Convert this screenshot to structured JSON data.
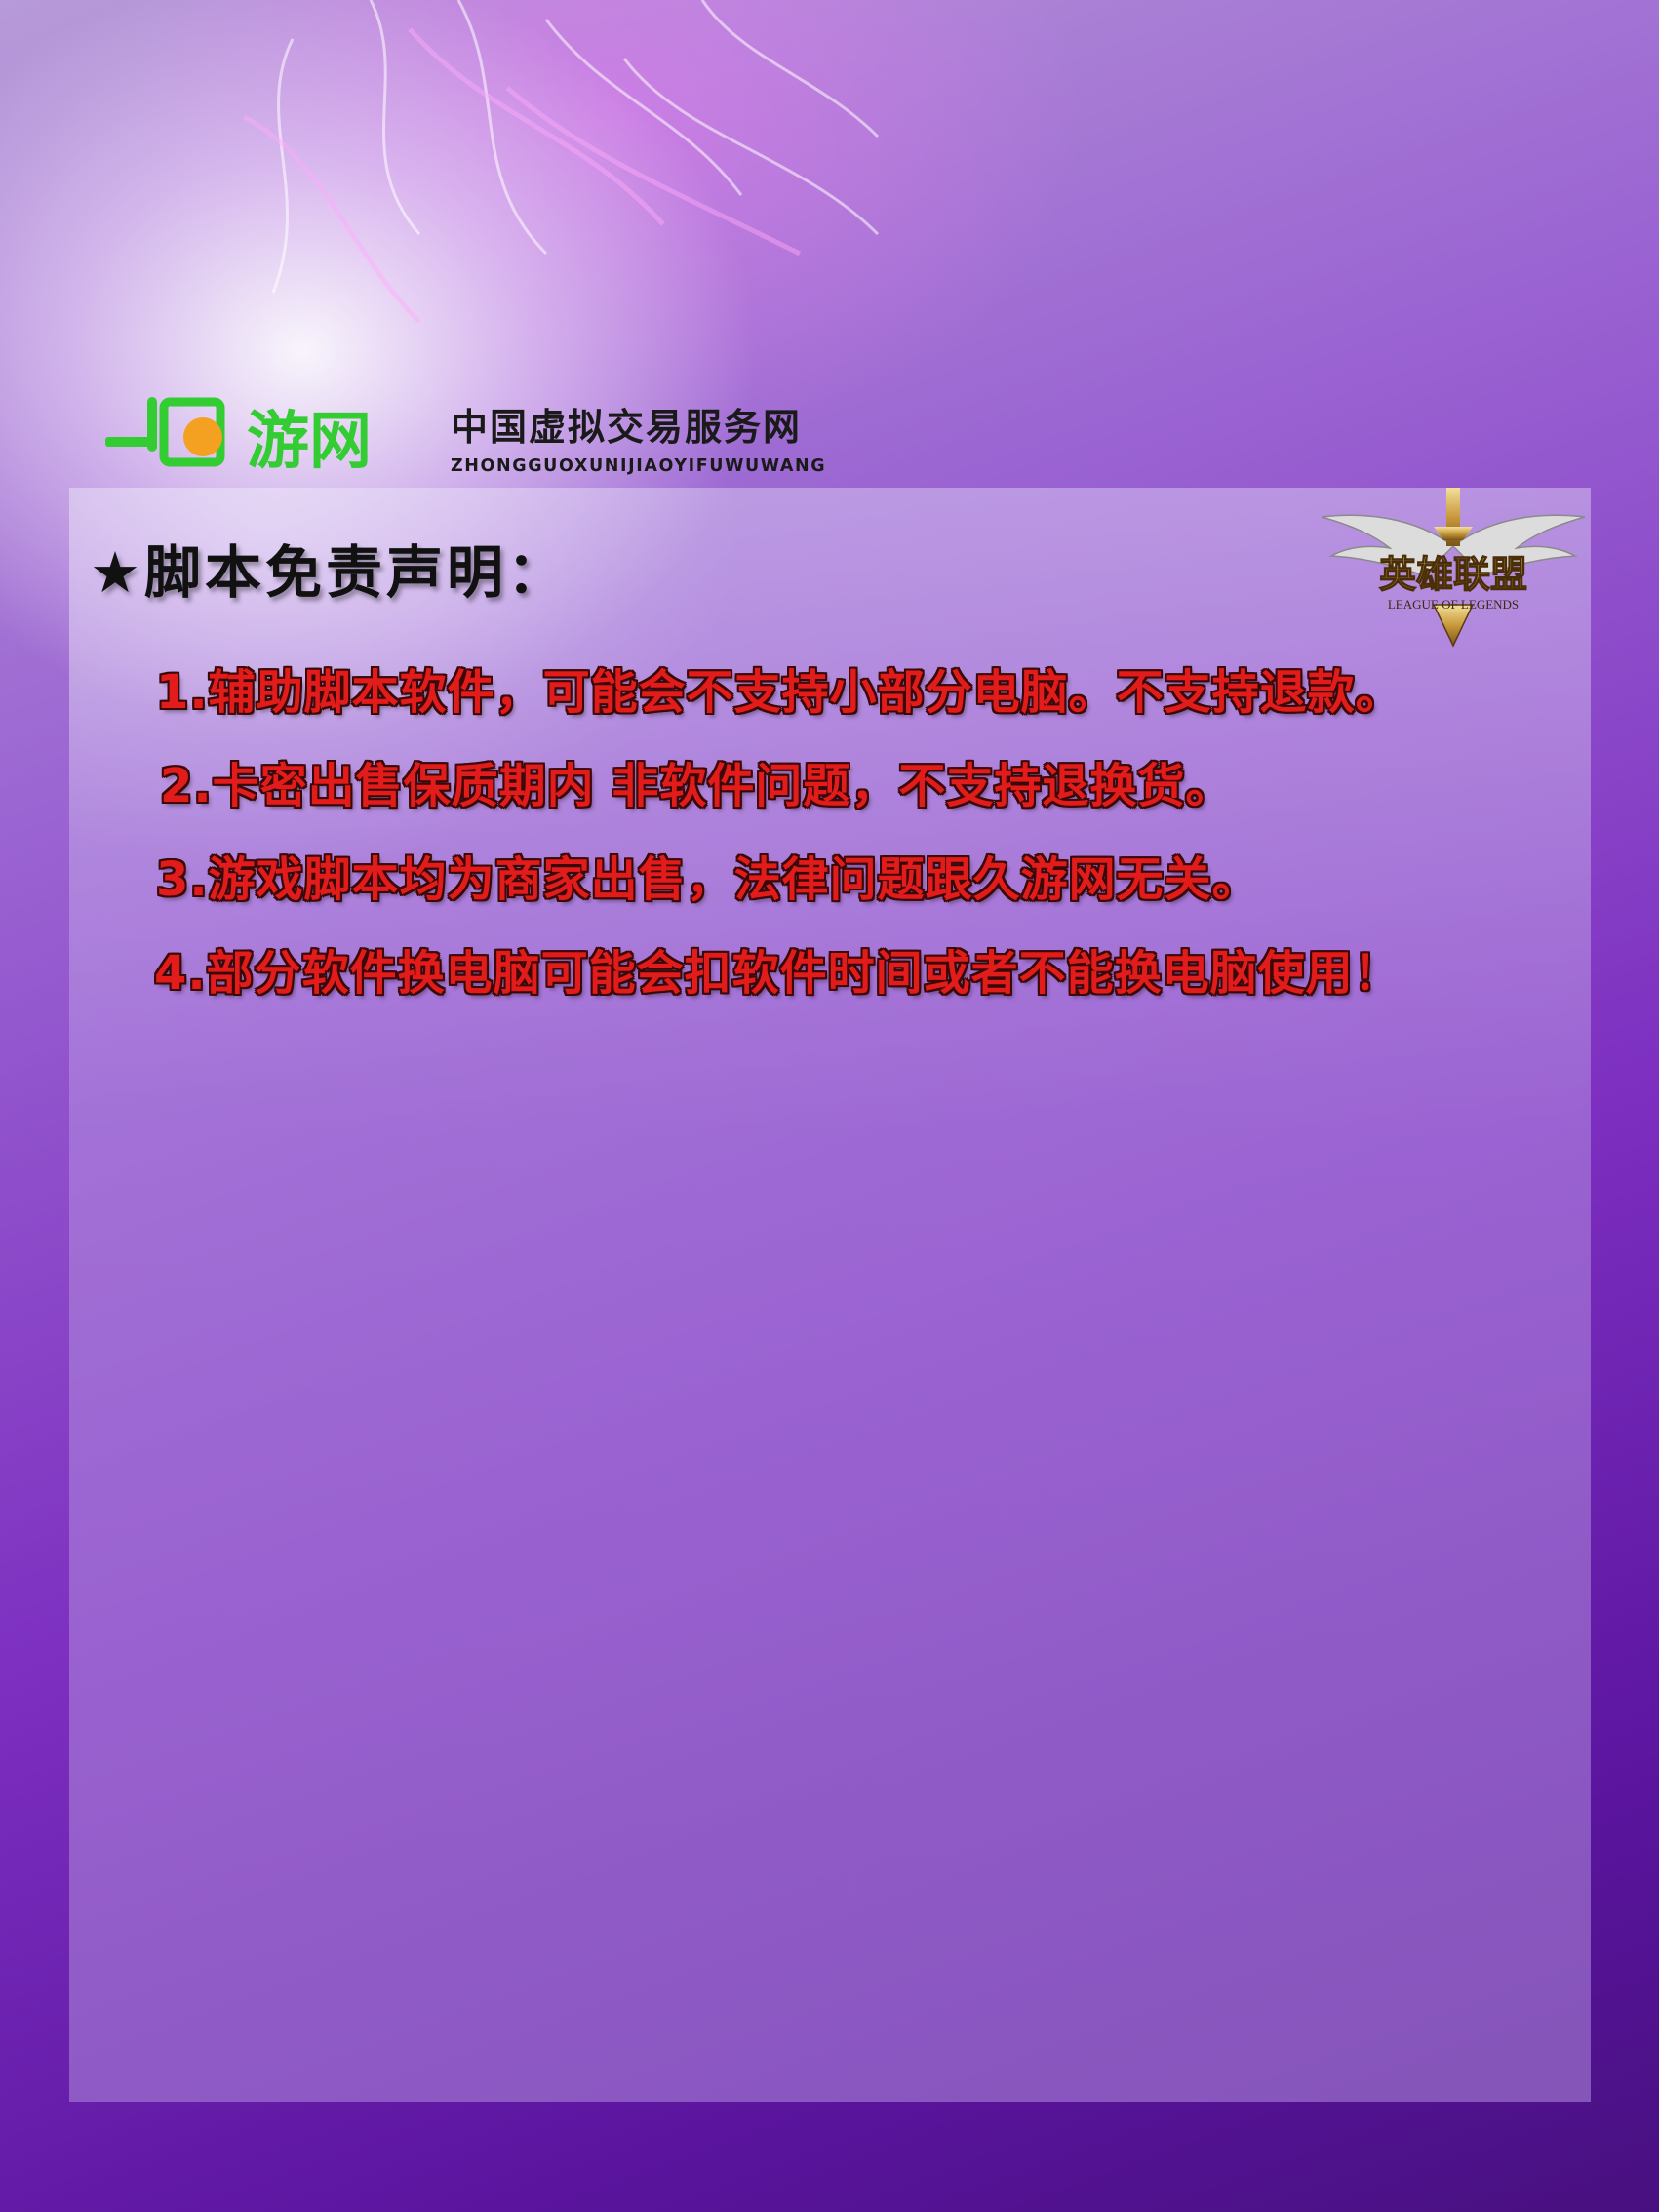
{
  "header": {
    "logo_text": "游网",
    "logo_prefix": "JJ",
    "slogan_cn": "中国虚拟交易服务网",
    "slogan_en": "ZHONGGUOXUNIJIAOYIFUWUWANG",
    "logo_color": "#33cc33",
    "logo_dot_color": "#f4a020"
  },
  "game_logo": {
    "title_cn": "英雄联盟",
    "title_en": "LEAGUE OF LEGENDS",
    "icon": "lol-wings-logo"
  },
  "notice": {
    "heading": "★脚本免责声明：",
    "items": [
      "1.辅助脚本软件，可能会不支持小部分电脑。不支持退款。",
      "2.卡密出售保质期内 非软件问题，不支持退换货。",
      "3.游戏脚本均为商家出售，法律问题跟久游网无关。",
      "4.部分软件换电脑可能会扣软件时间或者不能换电脑使用！"
    ],
    "item_color": "#e21b1b"
  },
  "colors": {
    "background_top": "#b79ad8",
    "background_bottom": "#47107f",
    "panel": "#c4aae8"
  }
}
